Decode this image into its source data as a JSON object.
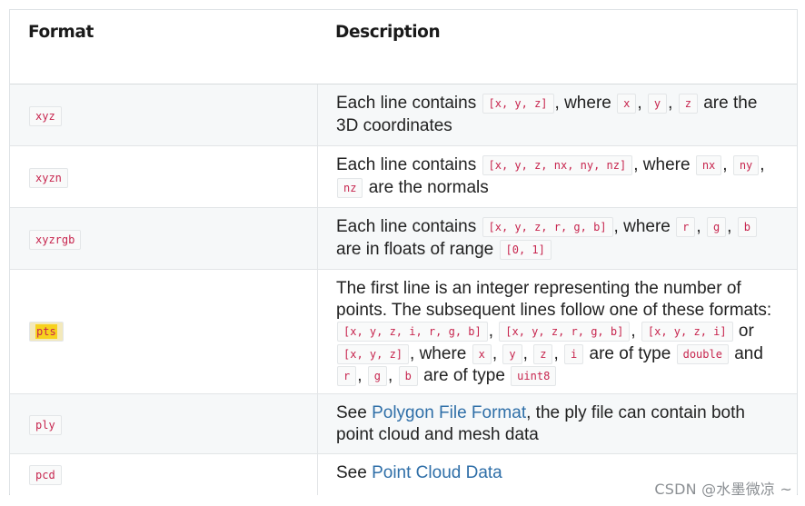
{
  "header": {
    "format": "Format",
    "description": "Description"
  },
  "rows": [
    {
      "format": "xyz",
      "desc": {
        "t1": "Each line contains",
        "c1": "[x, y, z]",
        "t2": ", where",
        "c2": "x",
        "t3": ",",
        "c3": "y",
        "t4": ",",
        "c4": "z",
        "t5": "are the 3D coordinates"
      }
    },
    {
      "format": "xyzn",
      "desc": {
        "t1": "Each line contains",
        "c1": "[x, y, z, nx, ny, nz]",
        "t2": ", where",
        "c2": "nx",
        "t3": ",",
        "c3": "ny",
        "t4": ",",
        "c4": "nz",
        "t5": "are the normals"
      }
    },
    {
      "format": "xyzrgb",
      "desc": {
        "t1": "Each line contains",
        "c1": "[x, y, z, r, g, b]",
        "t2": ", where",
        "c2": "r",
        "t3": ",",
        "c3": "g",
        "t4": ",",
        "c4": "b",
        "t5": "are in floats of range",
        "c5": "[0, 1]"
      }
    },
    {
      "format": "pts",
      "desc": {
        "t1": "The first line is an integer representing the number of points. The subsequent lines follow one of these formats:",
        "c1": "[x, y, z, i, r, g, b]",
        "t2": ",",
        "c2": "[x, y, z, r, g, b]",
        "t3": ",",
        "c3": "[x, y, z, i]",
        "t4": "or",
        "c4": "[x, y, z]",
        "t5": ", where",
        "c5": "x",
        "t6": ",",
        "c6": "y",
        "t7": ",",
        "c7": "z",
        "t8": ",",
        "c8": "i",
        "t9": "are of type",
        "c9": "double",
        "t10": "and",
        "c10": "r",
        "t11": ",",
        "c11": "g",
        "t12": ",",
        "c12": "b",
        "t13": "are of type",
        "c13": "uint8"
      }
    },
    {
      "format": "ply",
      "desc": {
        "t1": "See",
        "link": "Polygon File Format",
        "t2": ", the ply file can contain both point cloud and mesh data"
      }
    },
    {
      "format": "pcd",
      "desc": {
        "t1": "See",
        "link": "Point Cloud Data"
      }
    }
  ],
  "watermark": "CSDN @水墨微凉 ~",
  "colors": {
    "code_text": "#c7254e",
    "link": "#2f6fa8",
    "shaded_row": "#f6f8f9",
    "highlight": "#f7d21e"
  }
}
